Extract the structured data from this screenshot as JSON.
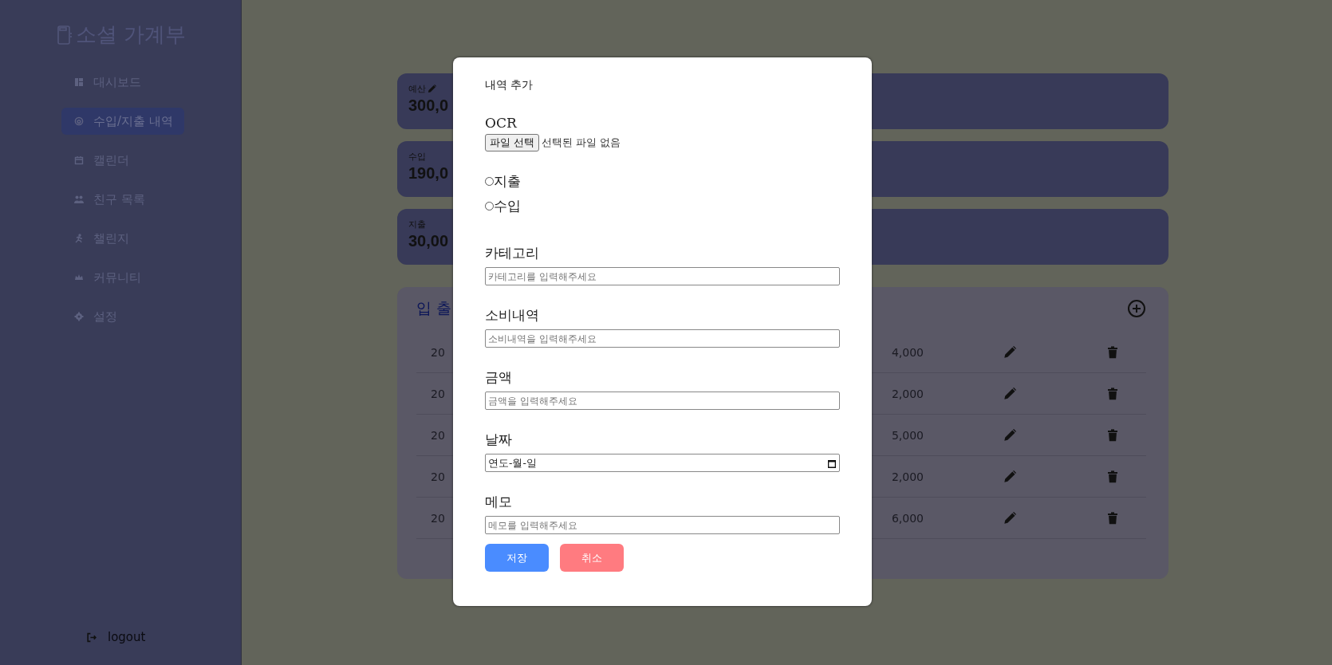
{
  "sidebar": {
    "logo": "소셜 가계부",
    "items": [
      {
        "label": "대시보드",
        "selected": false
      },
      {
        "label": "수입/지출 내역",
        "selected": true
      },
      {
        "label": "캘린더",
        "selected": false
      },
      {
        "label": "친구 목록",
        "selected": false
      },
      {
        "label": "챌린지",
        "selected": false
      },
      {
        "label": "커뮤니티",
        "selected": false
      },
      {
        "label": "설정",
        "selected": false
      }
    ],
    "logout": "logout"
  },
  "summary_cards": [
    {
      "label": "예산",
      "amount": "300,0",
      "editable": true
    },
    {
      "label": "수입",
      "amount": "190,0",
      "editable": false
    },
    {
      "label": "지출",
      "amount": "30,00",
      "editable": false
    }
  ],
  "history": {
    "title": "입 출",
    "rows": [
      {
        "date": "20",
        "amount": "4,000"
      },
      {
        "date": "20",
        "amount": "2,000"
      },
      {
        "date": "20",
        "amount": "5,000"
      },
      {
        "date": "20",
        "amount": "2,000"
      },
      {
        "date": "20",
        "amount": "6,000"
      }
    ]
  },
  "modal": {
    "title": "내역 추가",
    "ocr_label": "OCR",
    "file_button": "파일 선택",
    "file_status": "선택된 파일 없음",
    "radios": [
      {
        "label": "지출",
        "selected": false
      },
      {
        "label": "수입",
        "selected": false
      }
    ],
    "fields": [
      {
        "label": "카테고리",
        "kind": "text",
        "placeholder": "카테고리를 입력해주세요"
      },
      {
        "label": "소비내역",
        "kind": "text",
        "placeholder": "소비내역을 입력해주세요"
      },
      {
        "label": "금액",
        "kind": "text",
        "placeholder": "금액을 입력해주세요"
      },
      {
        "label": "날짜",
        "kind": "date",
        "value": "연도-월-일"
      },
      {
        "label": "메모",
        "kind": "text",
        "placeholder": "메모를 입력해주세요"
      }
    ],
    "buttons": [
      {
        "label": "저장",
        "kind": "primary"
      },
      {
        "label": "취소",
        "kind": "cancel"
      }
    ]
  }
}
